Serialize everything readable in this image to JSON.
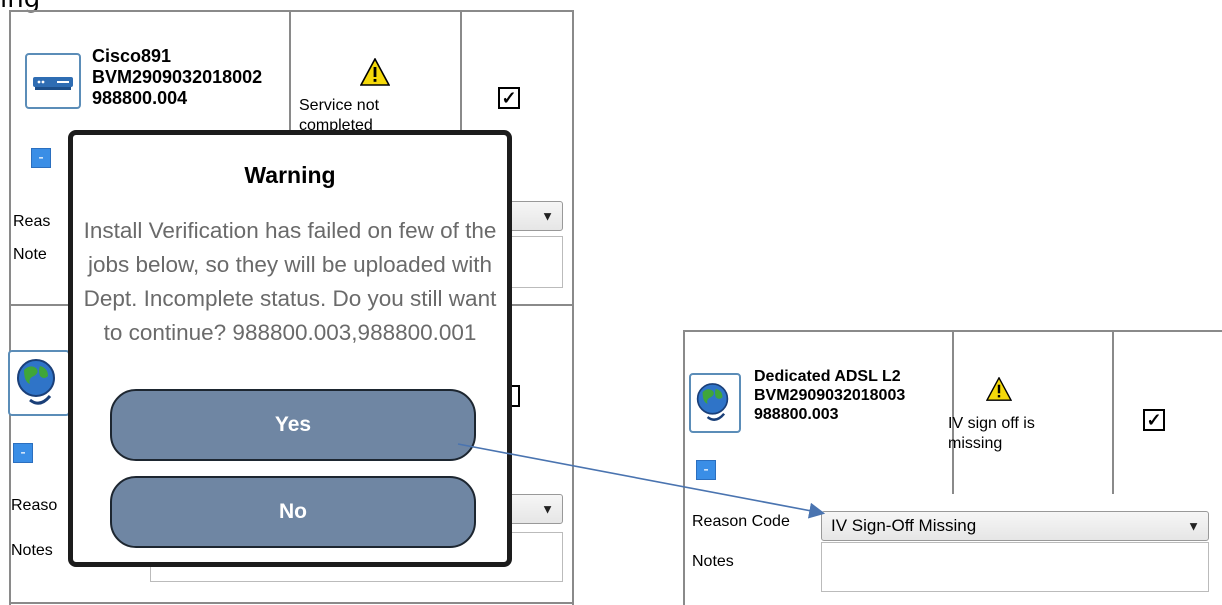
{
  "top_label": "ing",
  "left_panel": {
    "job1": {
      "device_name": "Cisco891",
      "serial": "BVM2909032018002",
      "job_id": "988800.004",
      "status": "Service not completed",
      "checked": true,
      "collapse_label": "-",
      "reason_label": "Reas",
      "notes_label": "Note"
    },
    "job2": {
      "collapse_label": "-",
      "reason_label": "Reaso",
      "notes_label": "Notes"
    }
  },
  "dialog": {
    "title": "Warning",
    "message": "Install Verification has failed on few of the jobs below, so they will be uploaded with Dept. Incomplete status. Do you still want to continue? 988800.003,988800.001",
    "yes_label": "Yes",
    "no_label": "No"
  },
  "right_panel": {
    "device_name": "Dedicated ADSL L2",
    "serial": "BVM2909032018003",
    "job_id": "988800.003",
    "status": "IV sign off is missing",
    "checked": true,
    "collapse_label": "-",
    "reason_label": "Reason Code",
    "reason_value": "IV Sign-Off Missing",
    "notes_label": "Notes"
  },
  "icons": {
    "router": "router-device-icon",
    "globe": "globe-network-icon",
    "warning": "warning-triangle-icon",
    "checkbox": "checkbox-checked-icon",
    "dropdown": "dropdown-arrow-icon"
  },
  "colors": {
    "button_fill": "#6f86a3",
    "accent_blue": "#3a8ee6",
    "arrow": "#4a74b0",
    "warning_yellow": "#f5d90a"
  }
}
